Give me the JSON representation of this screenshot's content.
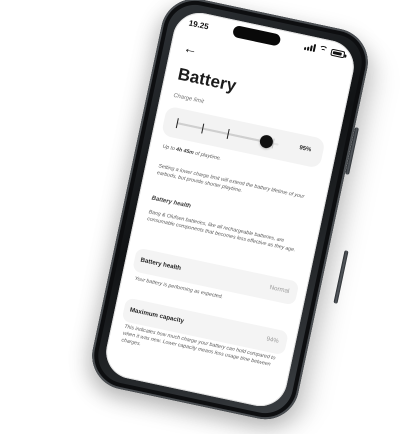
{
  "status_bar": {
    "time": "19.25",
    "icons": [
      "signal-icon",
      "wifi-icon",
      "battery-icon"
    ]
  },
  "navigation": {
    "back_label": "←"
  },
  "header": {
    "title": "Battery"
  },
  "charge_limit": {
    "label": "Charge limit",
    "value_label": "95%",
    "slider_level_percent": 95,
    "playtime_prefix": "Up to ",
    "playtime_value": "4h 45m",
    "playtime_suffix": " of playtime.",
    "description": "Setting a lower charge limit will extend the battery lifetime of your earbuds, but provide shorter playtime."
  },
  "battery_health_section": {
    "heading": "Battery health",
    "description": "Bang & Olufsen batteries, like all rechargeable batteries, are consumable components that becomes less effective as they age."
  },
  "battery_health_row": {
    "label": "Battery health",
    "value": "Normal",
    "description": "Your battery is performing as expected."
  },
  "maximum_capacity_row": {
    "label": "Maximum capacity",
    "value": "94%",
    "description": "This indicates how much charge your battery can hold compared to when it was new. Lower capacity means less usage time between charges."
  },
  "colors": {
    "frame": "#111315",
    "screen": "#ffffff",
    "card": "#f4f4f4",
    "accent": "#101010"
  }
}
